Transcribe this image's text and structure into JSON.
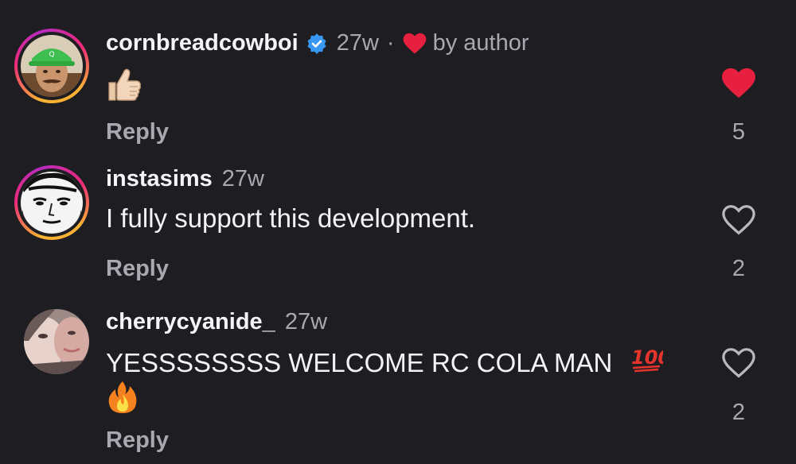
{
  "comments": [
    {
      "username": "cornbreadcowboi",
      "verified": true,
      "age": "27w",
      "separator": "·",
      "author_liked_label": "by author",
      "text_emoji": "thumbs-up",
      "reply_label": "Reply",
      "liked": true,
      "like_count": "5"
    },
    {
      "username": "instasims",
      "age": "27w",
      "text": "I fully support this development.",
      "reply_label": "Reply",
      "liked": false,
      "like_count": "2"
    },
    {
      "username": "cherrycyanide_",
      "age": "27w",
      "text": "YESSSSSSSS WELCOME RC COLA MAN",
      "text_emojis": [
        "hundred-points",
        "fire"
      ],
      "reply_label": "Reply",
      "liked": false,
      "like_count": "2"
    }
  ],
  "colors": {
    "background": "#1e1e22",
    "like_red": "#e8203f",
    "verified_blue": "#3897f0",
    "secondary_text": "#a8a8b0"
  }
}
